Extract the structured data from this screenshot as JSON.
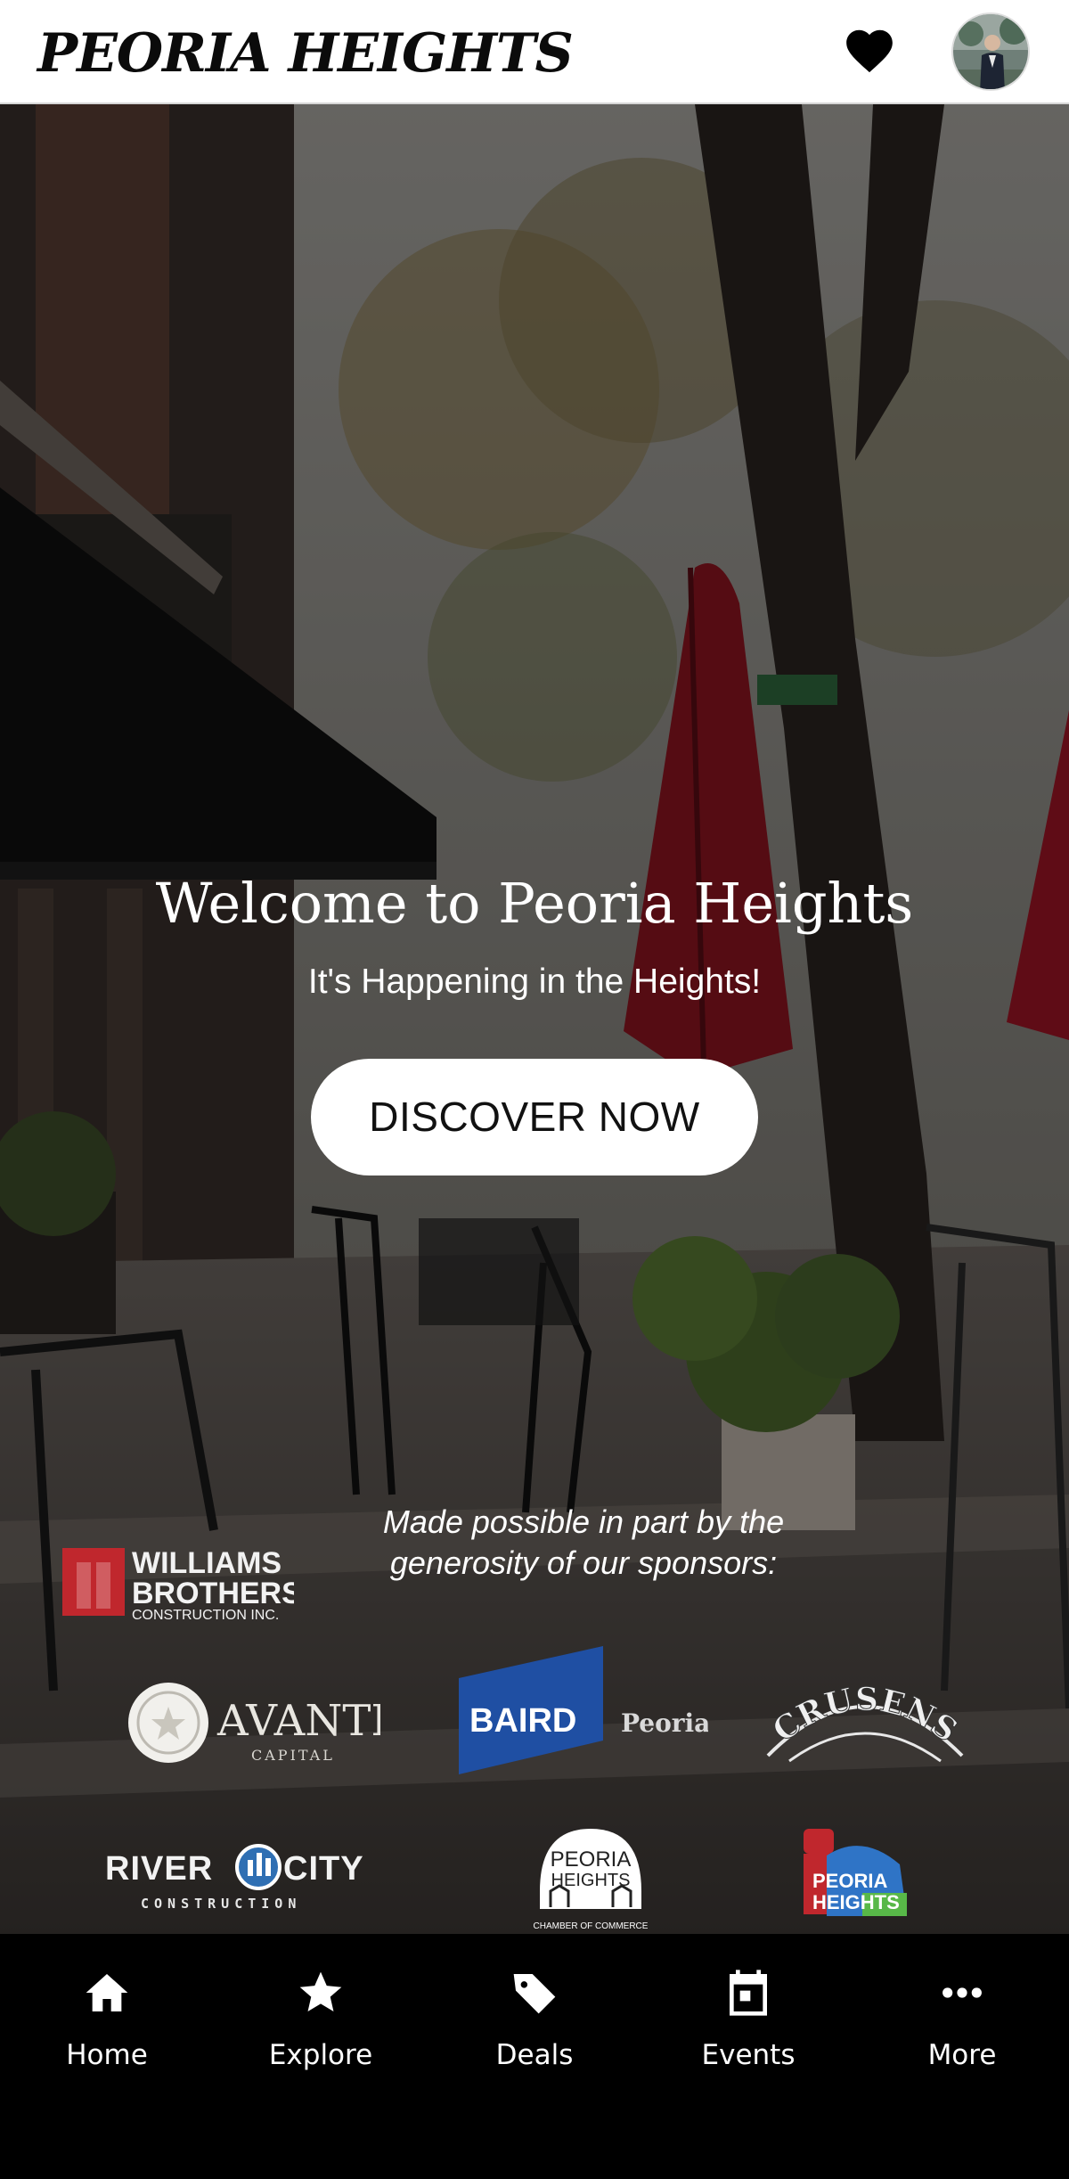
{
  "header": {
    "title": "PEORIA HEIGHTS",
    "favorites_icon": "heart-icon",
    "avatar": "user-avatar"
  },
  "hero": {
    "title": "Welcome to Peoria Heights",
    "tagline": "It's Happening in the Heights!",
    "cta_label": "DISCOVER NOW"
  },
  "sponsors": {
    "intro": "Made possible in part by the generosity of our sponsors:",
    "logos": {
      "williams": [
        "WILLIAMS",
        "BROTHERS",
        "CONSTRUCTION INC."
      ],
      "avanti": [
        "AVANTI",
        "CAPITAL"
      ],
      "baird": [
        "BAIRD",
        "Peoria"
      ],
      "crusens": "CRUSENS",
      "river_city": [
        "RIVER",
        "CITY",
        "CONSTRUCTION"
      ],
      "chamber": [
        "PEORIA",
        "HEIGHTS",
        "CHAMBER OF COMMERCE"
      ],
      "peoria_heights": [
        "PEORIA",
        "HEIGHTS"
      ]
    }
  },
  "nav": {
    "items": [
      {
        "label": "Home",
        "icon": "home-icon"
      },
      {
        "label": "Explore",
        "icon": "star-icon"
      },
      {
        "label": "Deals",
        "icon": "tag-icon"
      },
      {
        "label": "Events",
        "icon": "calendar-icon"
      },
      {
        "label": "More",
        "icon": "more-icon"
      }
    ]
  },
  "colors": {
    "header_bg": "#ffffff",
    "nav_bg": "#000000",
    "umbrella_red": "#8e1420",
    "baird_blue": "#1f4fa3"
  }
}
